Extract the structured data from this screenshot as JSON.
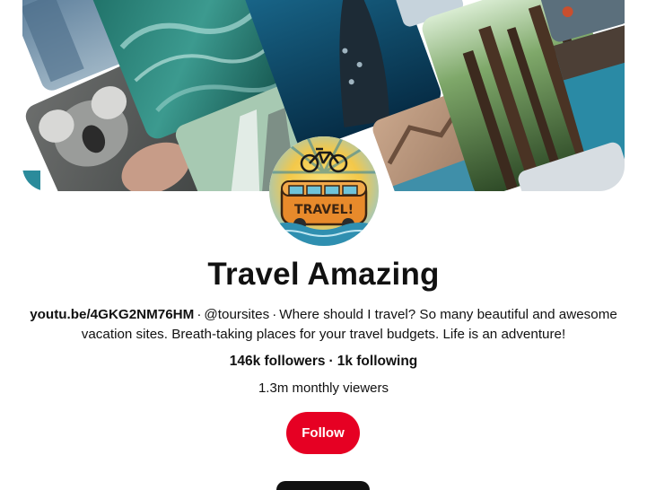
{
  "profile": {
    "name": "Travel Amazing",
    "website": "youtu.be/4GKG2NM76HM",
    "handle": "@toursites",
    "separator": "·",
    "bio": "Where should I travel? So many beautiful and awesome vacation sites. Breath-taking places for your travel budgets. Life is an adventure!",
    "followers": "146k followers",
    "following": "1k following",
    "monthly_viewers": "1.3m monthly viewers",
    "avatar_text": "TRAVEL!",
    "avatar_icons": [
      "bicycle-icon",
      "van-icon"
    ]
  },
  "actions": {
    "follow_label": "Follow"
  },
  "colors": {
    "follow_button": "#e60023",
    "text": "#111111"
  }
}
